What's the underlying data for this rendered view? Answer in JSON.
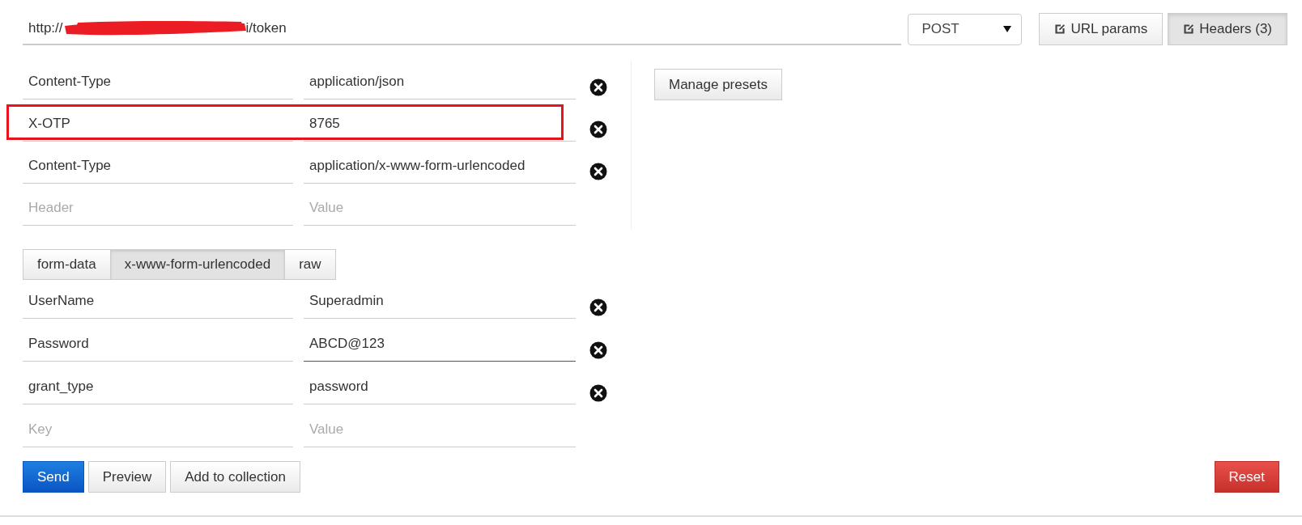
{
  "url": {
    "prefix": "http://",
    "suffix": "i/token",
    "redacted": true
  },
  "method": {
    "value": "POST"
  },
  "toggles": [
    {
      "label": "URL params",
      "selected": false
    },
    {
      "label": "Headers (3)",
      "selected": true
    }
  ],
  "headers": [
    {
      "key": "Content-Type",
      "value": "application/json",
      "highlighted": false
    },
    {
      "key": "X-OTP",
      "value": "8765",
      "highlighted": true
    },
    {
      "key": "Content-Type",
      "value": "application/x-www-form-urlencoded",
      "highlighted": false
    },
    {
      "key_placeholder": "Header",
      "value_placeholder": "Value",
      "highlighted": false
    }
  ],
  "presets_button": "Manage presets",
  "body_tabs": [
    {
      "label": "form-data",
      "selected": false
    },
    {
      "label": "x-www-form-urlencoded",
      "selected": true
    },
    {
      "label": "raw",
      "selected": false
    }
  ],
  "body_rows": [
    {
      "key": "UserName",
      "value": "Superadmin",
      "focused": false
    },
    {
      "key": "Password",
      "value": "ABCD@123",
      "focused": true
    },
    {
      "key": "grant_type",
      "value": "password",
      "focused": false
    },
    {
      "key_placeholder": "Key",
      "value_placeholder": "Value",
      "focused": false
    }
  ],
  "actions": [
    {
      "label": "Send",
      "kind": "primary"
    },
    {
      "label": "Preview",
      "kind": "default"
    },
    {
      "label": "Add to collection",
      "kind": "default"
    }
  ],
  "reset_button": "Reset"
}
